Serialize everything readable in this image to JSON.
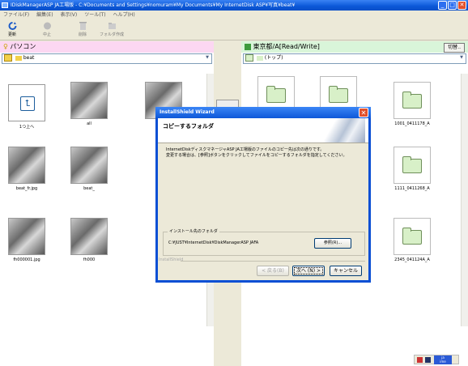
{
  "window": {
    "title": "IDiskManagerASP JA工場版 - C:¥Documents and Settings¥nomuram¥My Documents¥My InternetDisk ASP¥写真¥beat¥"
  },
  "menu": [
    "ファイル(F)",
    "編集(E)",
    "表示(V)",
    "ツール(T)",
    "ヘルプ(H)"
  ],
  "toolbar": [
    "更新",
    "中止",
    "削除",
    "フォルダ作成"
  ],
  "left_pane": {
    "title": "パソコン",
    "path": "beat",
    "items": [
      {
        "label": "1つ上へ",
        "kind": "up"
      },
      {
        "label": "all",
        "kind": "photo"
      },
      {
        "label": "",
        "kind": "photo"
      },
      {
        "label": "beat_fr.jpg",
        "kind": "photo"
      },
      {
        "label": "beat_",
        "kind": "photo"
      },
      {
        "label": "fh000001.jpg",
        "kind": "photo"
      },
      {
        "label": "fh000",
        "kind": "photo"
      }
    ]
  },
  "right_pane": {
    "title": "東京都/A[Read/Write]",
    "switch_label": "切替..",
    "path": "(トップ)",
    "items": [
      {
        "label": "",
        "kind": "folder"
      },
      {
        "label": "",
        "kind": "folder"
      },
      {
        "label": "1001_0411178_A",
        "kind": "folder"
      },
      {
        "label": "1111_0411268_A",
        "kind": "folder"
      },
      {
        "label": "2345_041124A_A",
        "kind": "folder"
      }
    ]
  },
  "dialog": {
    "title": "InstallShield Wizard",
    "heading": "コピーするフォルダ",
    "description_line1": "InternetDiskディスクマネージャASP JA工場版のファイルのコピー先は次の通りです。",
    "description_line2": "変更する場合は、[参照]ボタンをクリックしてファイルをコピーするフォルダを指定してください。",
    "group_label": "インストール先のフォルダ",
    "folder_path": "C:¥JUST¥InternetDisk¥DiskManagerASP JAFA",
    "browse_label": "参照(R)...",
    "footer_brand": "InstallShield",
    "back_label": "< 戻る(B)",
    "next_label": "次へ (N) >",
    "cancel_label": "キャンセル"
  },
  "tray": {
    "time_top": "ja",
    "time_bottom": "ime"
  }
}
